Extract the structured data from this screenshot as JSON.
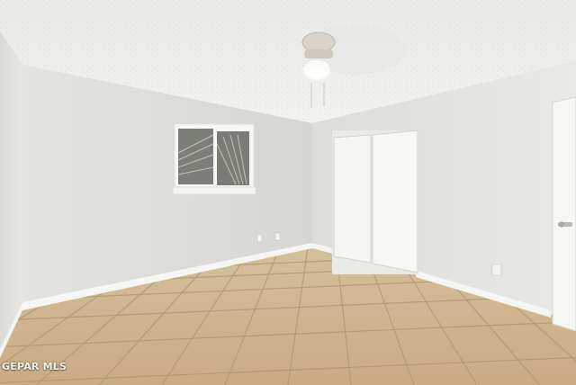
{
  "watermark": "GEPAR MLS",
  "colors": {
    "ceiling": "#f1f1ef",
    "left_wall": "#e6e6e3",
    "back_wall": "#dddeda",
    "right_wall": "#e2e3e0",
    "floor_tile": "#cfb48e",
    "grout": "#b69c77",
    "baseboard": "#f7f7f5",
    "door": "#f5f5f3"
  }
}
